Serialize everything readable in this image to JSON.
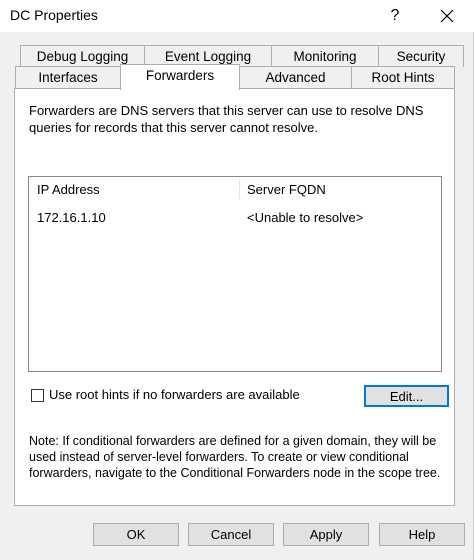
{
  "window": {
    "title": "DC Properties",
    "help_glyph": "?"
  },
  "tabs": {
    "row1": [
      "Debug Logging",
      "Event Logging",
      "Monitoring",
      "Security"
    ],
    "row2": [
      "Interfaces",
      "Forwarders",
      "Advanced",
      "Root Hints"
    ],
    "active": "Forwarders"
  },
  "forwarders": {
    "description": "Forwarders are DNS servers that this server can use to resolve DNS queries for records that this server cannot resolve.",
    "columns": [
      "IP Address",
      "Server FQDN"
    ],
    "rows": [
      {
        "ip": "172.16.1.10",
        "fqdn": "<Unable to resolve>"
      }
    ],
    "use_root_hints_label": "Use root hints if no forwarders are available",
    "use_root_hints_checked": false,
    "edit_label": "Edit...",
    "note": "Note: If conditional forwarders are defined for a given domain, they will be used instead of server-level forwarders.  To create or view conditional forwarders, navigate to the Conditional Forwarders node in the scope tree."
  },
  "buttons": {
    "ok": "OK",
    "cancel": "Cancel",
    "apply": "Apply",
    "help": "Help"
  },
  "colors": {
    "accent": "#0078d7",
    "panel_bg": "#ffffff",
    "dialog_bg": "#f0f0f0"
  }
}
